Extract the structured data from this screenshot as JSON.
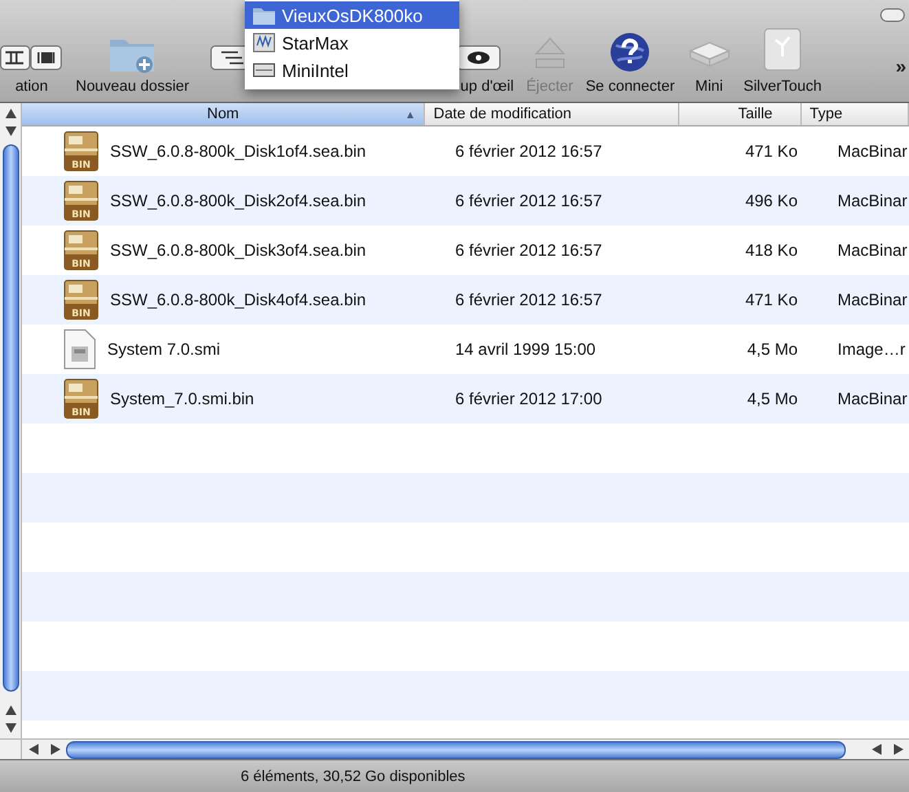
{
  "toolbar": {
    "items": [
      {
        "kind": "view",
        "label": "ation",
        "disabled": false
      },
      {
        "kind": "folder",
        "label": "Nouveau dossier",
        "disabled": false
      },
      {
        "kind": "path"
      },
      {
        "kind": "eye",
        "label": "up d'œil",
        "disabled": false
      },
      {
        "kind": "eject",
        "label": "Éjecter",
        "disabled": true
      },
      {
        "kind": "globe",
        "label": "Se connecter",
        "disabled": false
      },
      {
        "kind": "mini",
        "label": "Mini",
        "disabled": false
      },
      {
        "kind": "drive",
        "label": "SilverTouch",
        "disabled": false
      }
    ],
    "overflow": "»"
  },
  "menu": {
    "items": [
      {
        "kind": "folder",
        "label": "VieuxOsDK800ko",
        "selected": true
      },
      {
        "kind": "server",
        "label": "StarMax",
        "selected": false
      },
      {
        "kind": "disk",
        "label": "MiniIntel",
        "selected": false
      }
    ]
  },
  "table": {
    "columns": [
      {
        "label": "Nom",
        "selected": true,
        "sort": "▲"
      },
      {
        "label": "Date de modification",
        "selected": false
      },
      {
        "label": "Taille",
        "selected": false
      },
      {
        "label": "Type",
        "selected": false
      }
    ],
    "rows": [
      {
        "kind": "bin",
        "badge": "BIN",
        "name": "SSW_6.0.8-800k_Disk1of4.sea.bin",
        "date": "6 février 2012 16:57",
        "size": "471 Ko",
        "type": "MacBinar"
      },
      {
        "kind": "bin",
        "badge": "BIN",
        "name": "SSW_6.0.8-800k_Disk2of4.sea.bin",
        "date": "6 février 2012 16:57",
        "size": "496 Ko",
        "type": "MacBinar"
      },
      {
        "kind": "bin",
        "badge": "BIN",
        "name": "SSW_6.0.8-800k_Disk3of4.sea.bin",
        "date": "6 février 2012 16:57",
        "size": "418 Ko",
        "type": "MacBinar"
      },
      {
        "kind": "bin",
        "badge": "BIN",
        "name": "SSW_6.0.8-800k_Disk4of4.sea.bin",
        "date": "6 février 2012 16:57",
        "size": "471 Ko",
        "type": "MacBinar"
      },
      {
        "kind": "image",
        "name": "System 7.0.smi",
        "date": "14 avril 1999 15:00",
        "size": "4,5 Mo",
        "type": "Image…r"
      },
      {
        "kind": "bin",
        "badge": "BIN",
        "name": "System_7.0.smi.bin",
        "date": "6 février 2012 17:00",
        "size": "4,5 Mo",
        "type": "MacBinar"
      }
    ]
  },
  "status_bar": "6 éléments, 30,52 Go disponibles"
}
